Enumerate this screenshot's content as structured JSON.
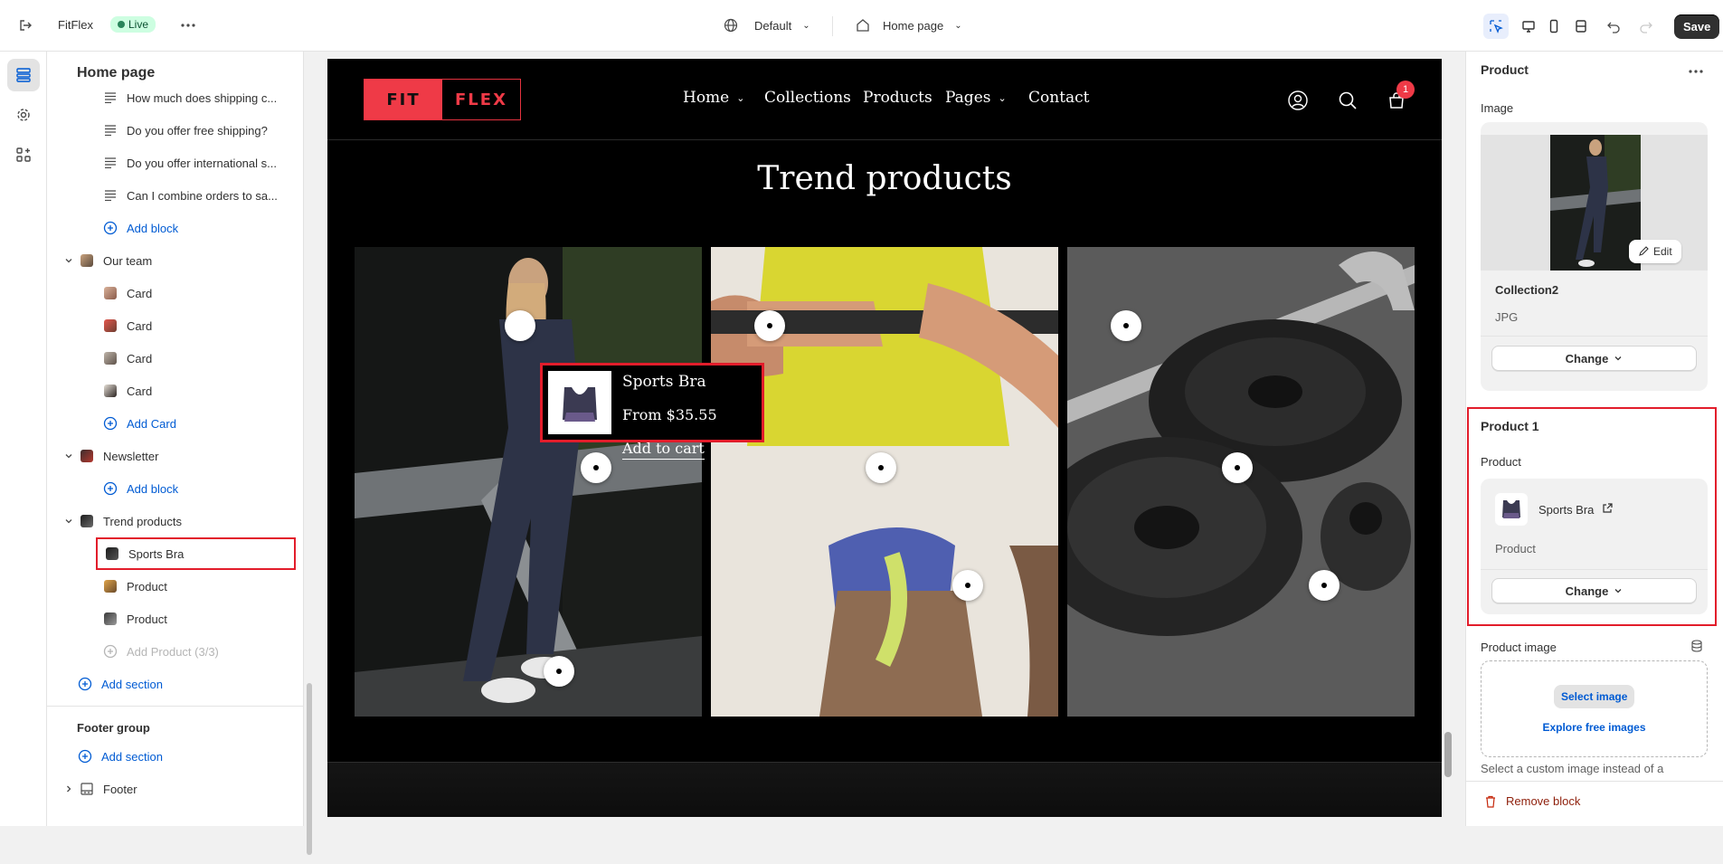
{
  "topbar": {
    "store_name": "FitFlex",
    "status": "Live",
    "theme": "Default",
    "page": "Home page",
    "save_label": "Save"
  },
  "left_panel": {
    "title": "Home page",
    "faq_items": [
      "How much does shipping c...",
      "Do you offer free shipping?",
      "Do you offer international s...",
      "Can I combine orders to sa..."
    ],
    "add_block": "Add block",
    "our_team": {
      "label": "Our team",
      "cards": [
        "Card",
        "Card",
        "Card",
        "Card"
      ],
      "add_card": "Add Card"
    },
    "newsletter": {
      "label": "Newsletter",
      "add_block": "Add block"
    },
    "trend_products": {
      "label": "Trend products",
      "items": [
        "Sports Bra",
        "Product",
        "Product"
      ],
      "add_product": "Add Product (3/3)"
    },
    "add_section": "Add section",
    "footer_group": {
      "label": "Footer group",
      "add_section": "Add section",
      "footer": "Footer"
    }
  },
  "preview": {
    "logo_left": "FIT",
    "logo_right": "FLEX",
    "nav": [
      "Home",
      "Collections",
      "Products",
      "Pages",
      "Contact"
    ],
    "cart_count": "1",
    "section_title": "Trend products",
    "popup": {
      "name": "Sports Bra",
      "price": "From $35.55",
      "cta": "Add to cart"
    }
  },
  "right_panel": {
    "header": "Product",
    "image_label": "Image",
    "edit_label": "Edit",
    "image_name": "Collection2",
    "image_type": "JPG",
    "change_label": "Change",
    "product1_title": "Product 1",
    "product_label": "Product",
    "product_name": "Sports Bra",
    "product_sub": "Product",
    "product_image_label": "Product image",
    "select_image": "Select image",
    "explore_images": "Explore free images",
    "custom_image_note": "Select a custom image instead of a",
    "remove_block": "Remove block"
  },
  "colors": {
    "accent_red": "#ef3a47",
    "highlight_red": "#e21d2b",
    "link_blue": "#005bd3",
    "live_green": "#cdfee1"
  }
}
